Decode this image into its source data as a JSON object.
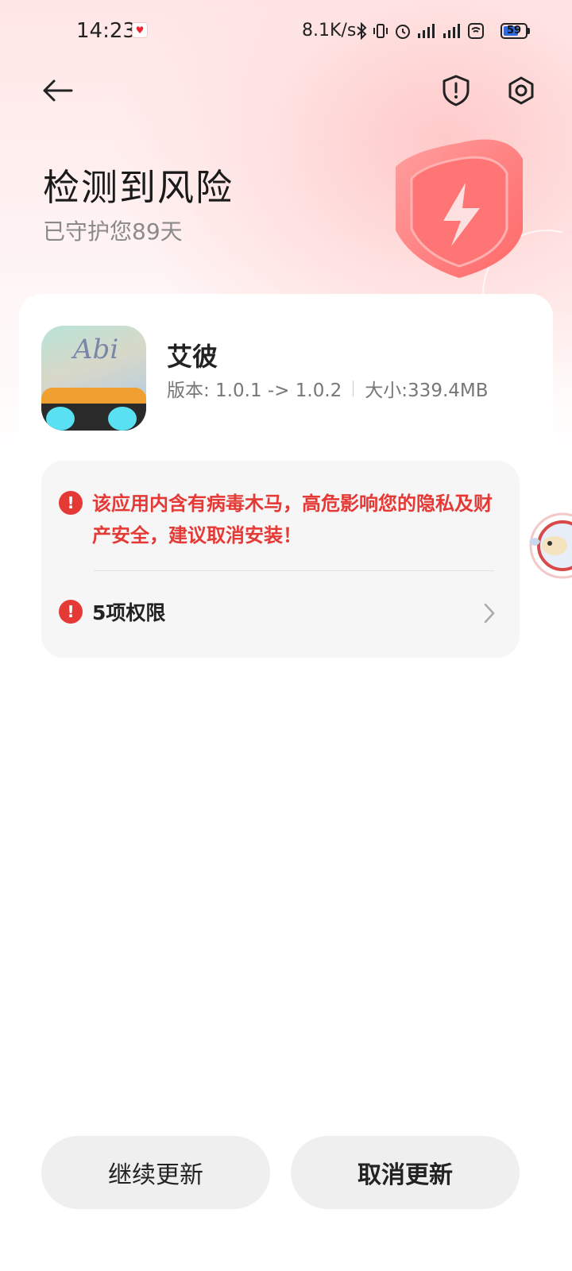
{
  "status_bar": {
    "time": "14:23",
    "network_speed": "8.1K/s",
    "battery": "59"
  },
  "header": {
    "title": "检测到风险",
    "subtitle": "已守护您89天"
  },
  "app": {
    "name": "艾彼",
    "icon_text": "Abi",
    "version": "版本: 1.0.1 -> 1.0.2",
    "size": "大小:339.4MB"
  },
  "risk": {
    "warning": "该应用内含有病毒木马，高危影响您的隐私及财产安全，建议取消安装！",
    "permissions": "5项权限"
  },
  "buttons": {
    "continue": "继续更新",
    "cancel": "取消更新"
  },
  "colors": {
    "danger": "#e53935",
    "accent_bg": "#ffe3e3"
  }
}
